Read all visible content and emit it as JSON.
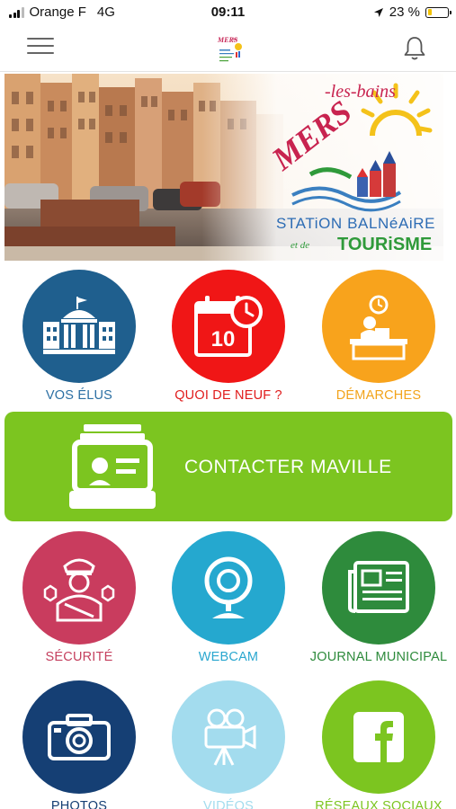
{
  "status_bar": {
    "carrier": "Orange F",
    "network": "4G",
    "time": "09:11",
    "battery": "23 %",
    "battery_level": 0.23
  },
  "banner": {
    "title_main": "MERS",
    "title_suffix": "-les-bains",
    "line1": "STATiON BALNéAiRE",
    "line2_small": "et de",
    "line2_big": "TOURiSME"
  },
  "tiles": [
    {
      "label": "VOS ÉLUS",
      "color": "#1f5f8e",
      "label_color": "#2b6fa3",
      "icon": "town-hall-icon"
    },
    {
      "label": "QUOI DE NEUF ?",
      "color": "#f01616",
      "label_color": "#e01b1b",
      "icon": "calendar-icon",
      "calendar_day": "10"
    },
    {
      "label": "DÉMARCHES",
      "color": "#f8a31c",
      "label_color": "#f2a31a",
      "icon": "service-desk-icon"
    },
    {
      "label": "SÉCURITÉ",
      "color": "#c93c5e",
      "label_color": "#c5415f",
      "icon": "police-officer-icon"
    },
    {
      "label": "WEBCAM",
      "color": "#25a8cf",
      "label_color": "#2aa7cf",
      "icon": "webcam-icon"
    },
    {
      "label": "JOURNAL MUNICIPAL",
      "color": "#2e8b3c",
      "label_color": "#2e8b3c",
      "icon": "newspaper-icon"
    },
    {
      "label": "PHOTOS",
      "color": "#153f74",
      "label_color": "#153f74",
      "icon": "camera-icon"
    },
    {
      "label": "VIDÉOS",
      "color": "#a3dcee",
      "label_color": "#a3dcee",
      "icon": "video-camera-icon"
    },
    {
      "label": "RÉSEAUX SOCIAUX",
      "color": "#7cc520",
      "label_color": "#7cc520",
      "icon": "facebook-icon"
    }
  ],
  "contact": {
    "label": "CONTACTER MAVILLE",
    "color": "#7cc520",
    "icon": "contact-card-icon"
  }
}
